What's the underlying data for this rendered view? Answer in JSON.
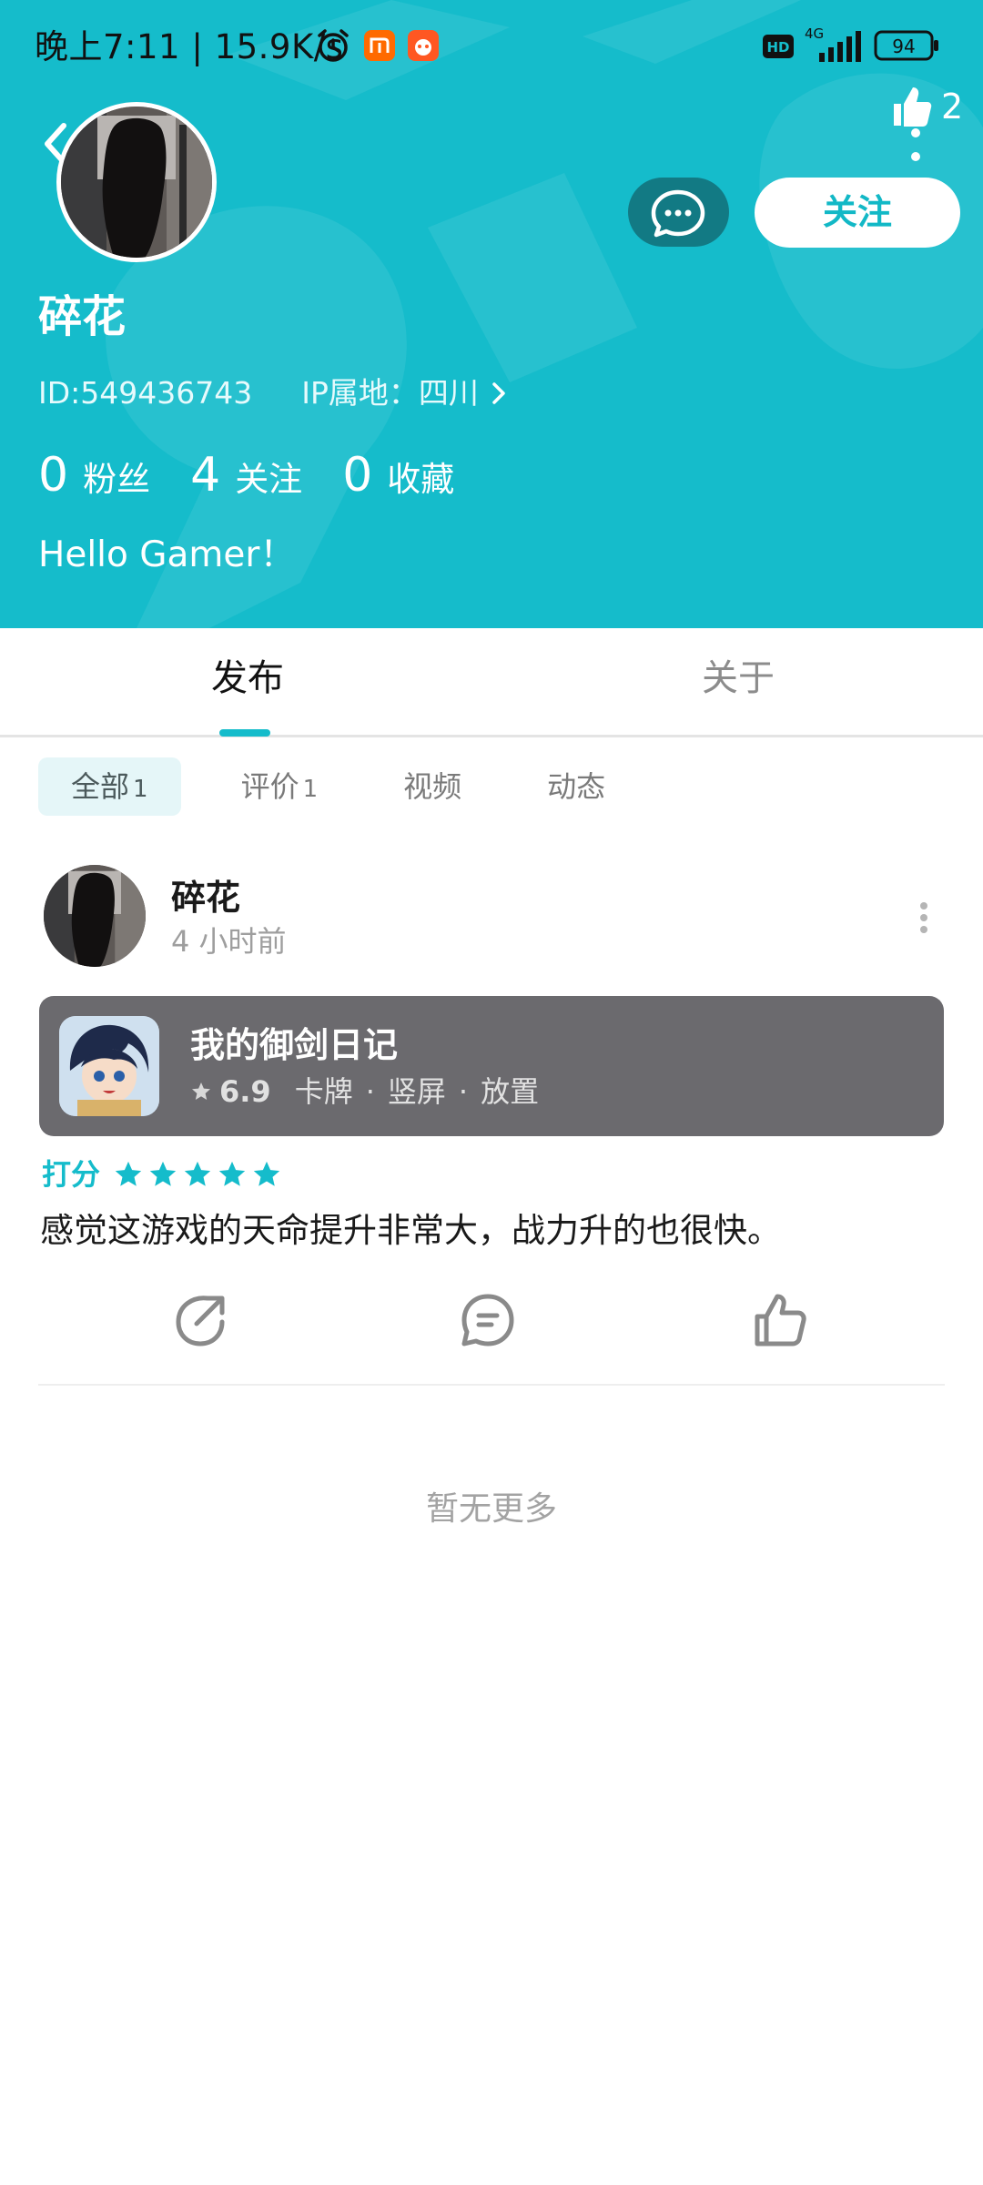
{
  "status_bar": {
    "time_speed": "晚上7:11 | 15.9K/s",
    "network": "4G",
    "hd": "HD",
    "battery": "94"
  },
  "header": {
    "like_count": "2",
    "follow_label": "关注",
    "username": "碎花",
    "user_id": "ID:549436743",
    "ip_location": "IP属地：四川",
    "stats": [
      {
        "value": "0",
        "label": "粉丝"
      },
      {
        "value": "4",
        "label": "关注"
      },
      {
        "value": "0",
        "label": "收藏"
      }
    ],
    "bio": "Hello Gamer！",
    "background_color": "#15bccb"
  },
  "tabs": [
    {
      "label": "发布",
      "active": true
    },
    {
      "label": "关于",
      "active": false
    }
  ],
  "sub_tabs": [
    {
      "label": "全部",
      "count": "1",
      "active": true
    },
    {
      "label": "评价",
      "count": "1",
      "active": false
    },
    {
      "label": "视频",
      "count": "",
      "active": false
    },
    {
      "label": "动态",
      "count": "",
      "active": false
    }
  ],
  "post": {
    "author": "碎花",
    "time": "4 小时前",
    "game": {
      "name": "我的御剑日记",
      "score": "6.9",
      "tags": [
        "卡牌",
        "竖屏",
        "放置"
      ]
    },
    "rating_label": "打分",
    "rating_stars": 5,
    "text": "感觉这游戏的天命提升非常大，战力升的也很快。"
  },
  "footer_text": "暂无更多",
  "accent_color": "#15bccb"
}
